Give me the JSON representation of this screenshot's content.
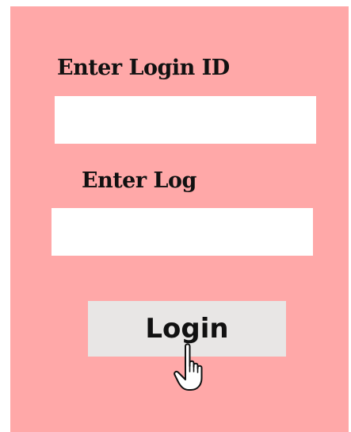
{
  "form": {
    "login_id_label": "Enter Login ID",
    "login_id_value": "",
    "password_label": "Enter Log",
    "password_value": "",
    "login_button_label": "Login"
  },
  "icons": {
    "pointer": "hand-pointer-icon"
  },
  "colors": {
    "panel_background": "#ffa8a8",
    "input_background": "#ffffff",
    "button_background": "#e8e6e5"
  }
}
